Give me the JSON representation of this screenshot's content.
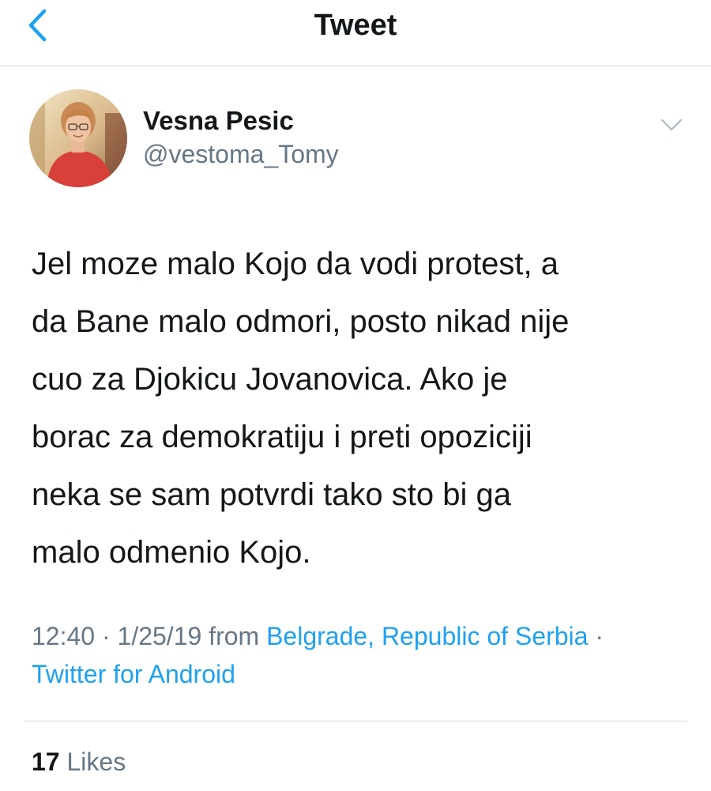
{
  "nav": {
    "title": "Tweet",
    "back_icon": "chevron-left-icon",
    "accent_color": "#1da1f2"
  },
  "author": {
    "display_name": "Vesna Pesic",
    "handle": "@vestoma_Tomy",
    "avatar_icon": "profile-photo",
    "menu_icon": "chevron-down-icon"
  },
  "tweet": {
    "lines": [
      "Jel moze malo Kojo da vodi protest, a",
      "da Bane malo odmori, posto nikad nije",
      "cuo za Djokicu Jovanovica. Ako je",
      "borac za demokratiju i preti opoziciji",
      "neka se sam potvrdi tako sto bi ga",
      "malo odmenio Kojo."
    ]
  },
  "meta": {
    "time": "12:40",
    "separator": "·",
    "date": "1/25/19",
    "from_label": "from",
    "location": "Belgrade, Republic of Serbia",
    "source": "Twitter for Android",
    "link_color": "#1da1f2"
  },
  "stats": {
    "likes_count": "17",
    "likes_label": "Likes"
  }
}
